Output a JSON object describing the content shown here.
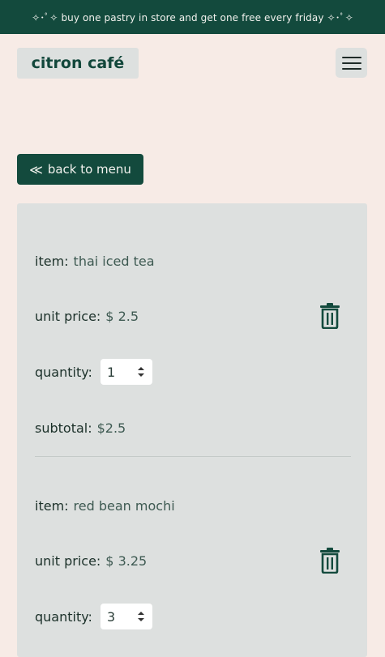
{
  "banner": {
    "text": "✧･ﾟ✧ buy one pastry in store and get one free every friday ✧･ﾟ✧"
  },
  "header": {
    "logo": "citron café",
    "menu_icon": "hamburger-menu-icon"
  },
  "back_button": {
    "label": "back to menu",
    "icon": "double-chevron-left-icon",
    "glyph": "≪"
  },
  "cart": {
    "labels": {
      "item": "item:",
      "unit_price": "unit price:",
      "quantity": "quantity:",
      "subtotal": "subtotal:"
    },
    "items": [
      {
        "name": "thai iced tea",
        "unit_price": "$ 2.5",
        "quantity": "1",
        "subtotal": "$2.5"
      },
      {
        "name": "red bean mochi",
        "unit_price": "$ 3.25",
        "quantity": "3"
      }
    ]
  },
  "colors": {
    "brand_green": "#134a3d",
    "page_bg": "#f7ebe6",
    "panel_bg": "#dde0df"
  }
}
